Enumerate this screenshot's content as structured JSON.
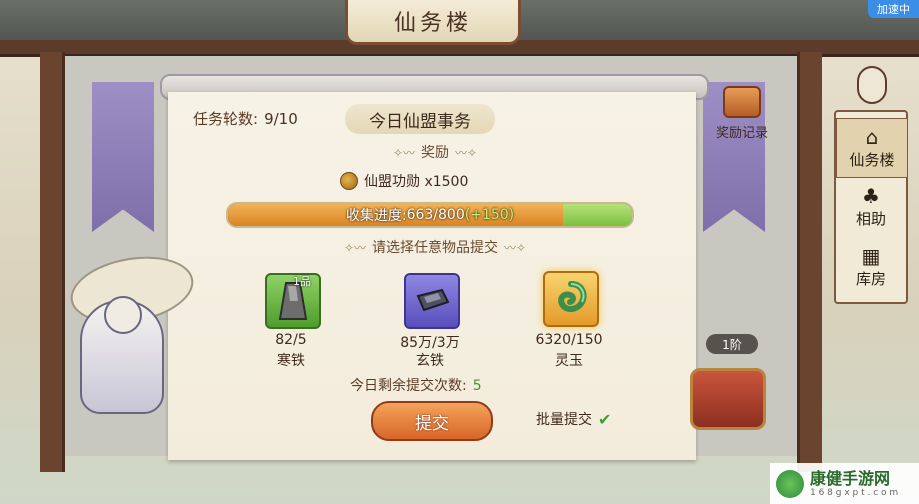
{
  "top": {
    "sign_title": "仙务楼",
    "accel_badge": "加速中"
  },
  "panel": {
    "task_round_label": "任务轮数:",
    "task_round_value": "9/10",
    "title": "今日仙盟事务",
    "reward_header": "奖励",
    "reward_item": "仙盟功勋 x1500",
    "progress": {
      "label": "收集进度:",
      "value": "663/800",
      "bonus": "(+150)",
      "current": 663,
      "bonus_amount": 150,
      "max": 800
    },
    "select_prompt": "请选择任意物品提交",
    "items": [
      {
        "count": "82/5",
        "name": "寒铁",
        "grade": "1品",
        "icon": "iron-ingot-icon"
      },
      {
        "count": "85万/3万",
        "name": "玄铁",
        "icon": "dark-iron-icon"
      },
      {
        "count": "6320/150",
        "name": "灵玉",
        "icon": "jade-icon"
      }
    ],
    "remaining_label": "今日剩余提交次数:",
    "remaining_value": "5",
    "submit_label": "提交",
    "batch_label": "批量提交"
  },
  "side": {
    "reward_record_label": "奖励记录",
    "stage_label": "1阶"
  },
  "nav": [
    {
      "label": "仙务楼",
      "icon": "tower-icon",
      "glyph": "⌂",
      "active": true
    },
    {
      "label": "相助",
      "icon": "gourd-icon",
      "glyph": "♣",
      "active": false
    },
    {
      "label": "库房",
      "icon": "warehouse-icon",
      "glyph": "▦",
      "active": false
    }
  ],
  "watermark": {
    "main": "康健手游网",
    "sub": "1 6 8 g x p t . c o m"
  },
  "colors": {
    "progress_fill": "#e89b3a",
    "progress_bonus": "#8fd04e",
    "remaining_value": "#3e9a2c",
    "submit": "#e07a35"
  }
}
